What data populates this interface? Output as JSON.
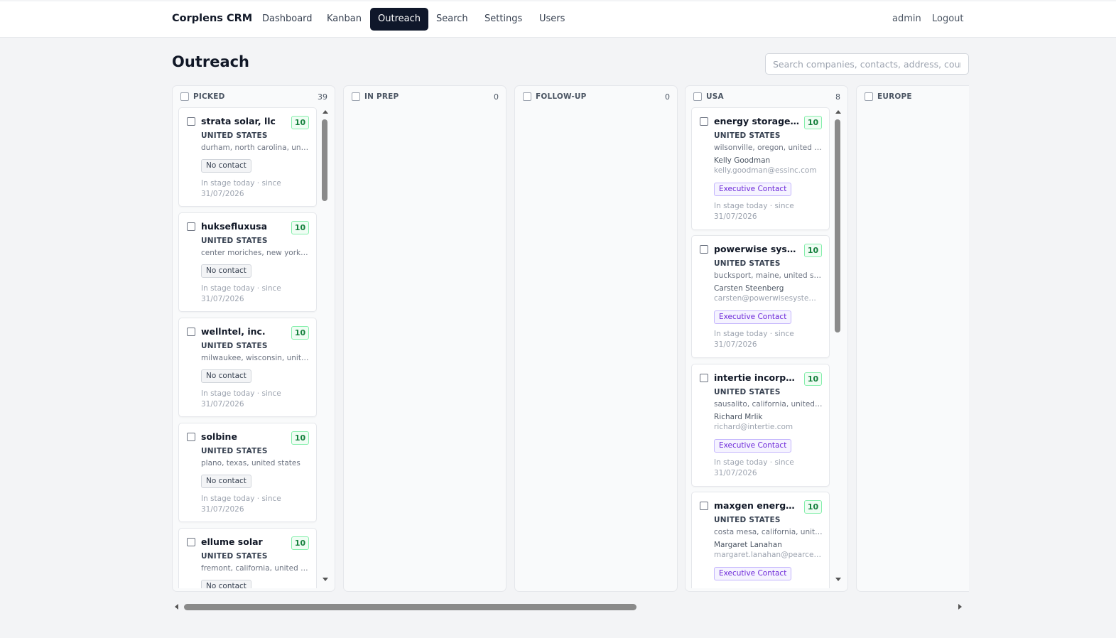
{
  "header": {
    "brand": "Corplens CRM",
    "nav": [
      {
        "label": "Dashboard",
        "active": false
      },
      {
        "label": "Kanban",
        "active": false
      },
      {
        "label": "Outreach",
        "active": true
      },
      {
        "label": "Search",
        "active": false
      },
      {
        "label": "Settings",
        "active": false
      },
      {
        "label": "Users",
        "active": false
      }
    ],
    "user": "admin",
    "logout": "Logout"
  },
  "page": {
    "title": "Outreach",
    "search_placeholder": "Search companies, contacts, address, country"
  },
  "columns": [
    {
      "title": "PICKED",
      "count": "39",
      "cards": [
        {
          "name": "strata solar, llc",
          "score": "10",
          "country": "UNITED STATES",
          "address": "durham, north carolina, united states",
          "badge": "No contact",
          "stage": "In stage today · since 31/07/2026"
        },
        {
          "name": "huksefluxusa",
          "score": "10",
          "country": "UNITED STATES",
          "address": "center moriches, new york, united states",
          "badge": "No contact",
          "stage": "In stage today · since 31/07/2026"
        },
        {
          "name": "wellntel, inc.",
          "score": "10",
          "country": "UNITED STATES",
          "address": "milwaukee, wisconsin, united states",
          "badge": "No contact",
          "stage": "In stage today · since 31/07/2026"
        },
        {
          "name": "solbine",
          "score": "10",
          "country": "UNITED STATES",
          "address": "plano, texas, united states",
          "badge": "No contact",
          "stage": "In stage today · since 31/07/2026"
        },
        {
          "name": "ellume solar",
          "score": "10",
          "country": "UNITED STATES",
          "address": "fremont, california, united states",
          "badge": "No contact",
          "stage": ""
        }
      ]
    },
    {
      "title": "IN PREP",
      "count": "0",
      "cards": []
    },
    {
      "title": "FOLLOW-UP",
      "count": "0",
      "cards": []
    },
    {
      "title": "USA",
      "count": "8",
      "cards": [
        {
          "name": "energy storage systems",
          "score": "10",
          "country": "UNITED STATES",
          "address": "wilsonville, oregon, united states",
          "contact_name": "Kelly Goodman",
          "contact_email": "kelly.goodman@essinc.com",
          "badge": "Executive Contact",
          "stage": "In stage today · since 31/07/2026"
        },
        {
          "name": "powerwise systems",
          "score": "10",
          "country": "UNITED STATES",
          "address": "bucksport, maine, united states",
          "contact_name": "Carsten Steenberg",
          "contact_email": "carsten@powerwisesystems.com",
          "badge": "Executive Contact",
          "stage": "In stage today · since 31/07/2026"
        },
        {
          "name": "intertie incorporated",
          "score": "10",
          "country": "UNITED STATES",
          "address": "sausalito, california, united states",
          "contact_name": "Richard Mrlik",
          "contact_email": "richard@intertie.com",
          "badge": "Executive Contact",
          "stage": "In stage today · since 31/07/2026"
        },
        {
          "name": "maxgen energy services",
          "score": "10",
          "country": "UNITED STATES",
          "address": "costa mesa, california, united states",
          "contact_name": "Margaret Lanahan",
          "contact_email": "margaret.lanahan@pearce-services.com",
          "badge": "Executive Contact",
          "stage": ""
        }
      ]
    },
    {
      "title": "EUROPE",
      "count": "",
      "cards": []
    }
  ],
  "colors": {
    "nav_active_bg": "#0f172a",
    "score_green": "#15803d",
    "exec_purple": "#6d28d9"
  }
}
